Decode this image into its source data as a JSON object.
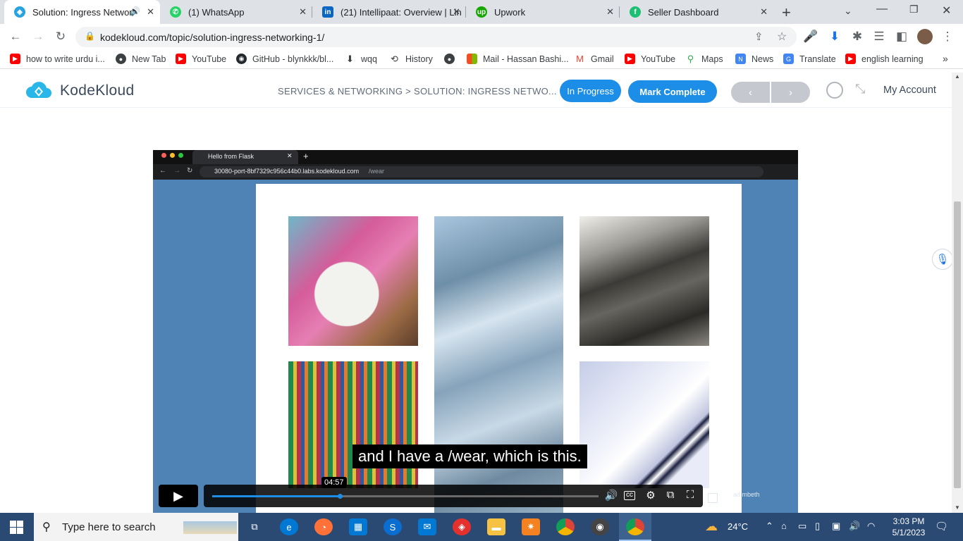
{
  "browser": {
    "tabs": [
      {
        "title": "Solution: Ingress Networ",
        "active": true
      },
      {
        "title": "(1) WhatsApp"
      },
      {
        "title": "(21) Intellipaat: Overview | Lin"
      },
      {
        "title": "Upwork"
      },
      {
        "title": "Seller Dashboard"
      }
    ],
    "url": "kodekloud.com/topic/solution-ingress-networking-1/",
    "bookmarks": [
      {
        "label": "how to write urdu i...",
        "icon": "youtube-icon"
      },
      {
        "label": "New Tab",
        "icon": "globe-icon"
      },
      {
        "label": "YouTube",
        "icon": "youtube-icon"
      },
      {
        "label": "GitHub - blynkkk/bl...",
        "icon": "github-icon"
      },
      {
        "label": "wqq",
        "icon": "download-icon"
      },
      {
        "label": "History",
        "icon": "history-icon"
      },
      {
        "label": "",
        "icon": "globe-icon"
      },
      {
        "label": "Mail - Hassan Bashi...",
        "icon": "microsoft-icon"
      },
      {
        "label": "Gmail",
        "icon": "gmail-icon"
      },
      {
        "label": "YouTube",
        "icon": "youtube-icon"
      },
      {
        "label": "Maps",
        "icon": "maps-icon"
      },
      {
        "label": "News",
        "icon": "news-icon"
      },
      {
        "label": "Translate",
        "icon": "translate-icon"
      },
      {
        "label": "english learning",
        "icon": "youtube-icon"
      }
    ]
  },
  "site": {
    "logo": "KodeKloud",
    "breadcrumb": "SERVICES & NETWORKING > SOLUTION: INGRESS NETWO...",
    "status_button": "In Progress",
    "complete_button": "Mark Complete",
    "account": "My Account"
  },
  "video": {
    "inner_tab_title": "Hello from Flask",
    "inner_url_host": "30080-port-8bf7329c956c44b0.labs.kodekloud.com",
    "inner_url_path": "/wear",
    "caption": "and I have a /wear, which is this.",
    "time": "04:57",
    "progress_fraction": 0.33,
    "watermark": "ad mbeth"
  },
  "taskbar": {
    "search_placeholder": "Type here to search",
    "temperature": "24°C",
    "time": "3:03 PM",
    "date": "5/1/2023"
  },
  "colors": {
    "brand_blue": "#1d8ee8",
    "video_bg": "#4f83b5",
    "taskbar": "#2b4a73"
  }
}
